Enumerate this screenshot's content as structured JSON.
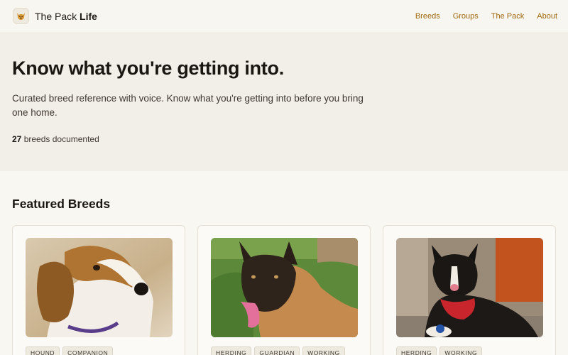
{
  "brand": {
    "name_regular": "The Pack",
    "name_bold": "Life",
    "icon": "dog-face-icon"
  },
  "nav": [
    {
      "label": "Breeds"
    },
    {
      "label": "Groups"
    },
    {
      "label": "The Pack"
    },
    {
      "label": "About"
    }
  ],
  "hero": {
    "title": "Know what you're getting into.",
    "subtitle": "Curated breed reference with voice. Know what you're getting into before you bring one home.",
    "count": "27",
    "count_suffix": "breeds documented"
  },
  "featured": {
    "title": "Featured Breeds",
    "cards": [
      {
        "image": "beagle-photo",
        "tags": [
          "HOUND",
          "COMPANION"
        ]
      },
      {
        "image": "malinois-photo",
        "tags": [
          "HERDING",
          "GUARDIAN",
          "WORKING"
        ]
      },
      {
        "image": "border-collie-photo",
        "tags": [
          "HERDING",
          "WORKING"
        ]
      }
    ]
  },
  "colors": {
    "accent": "#a0690f",
    "background": "#f9f7f1",
    "hero_background": "#f2efe8"
  }
}
